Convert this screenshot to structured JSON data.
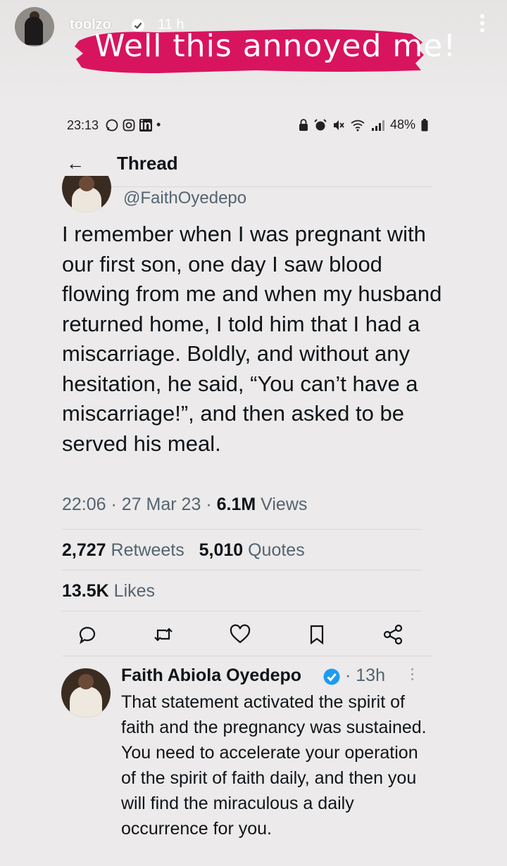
{
  "story": {
    "username": "toolzo",
    "time_ago": "11 h",
    "banner_text": "Well this annoyed me!",
    "banner_color": "#d8145f"
  },
  "status_bar": {
    "time": "23:13",
    "left_icons": [
      "whatsapp-icon",
      "instagram-icon",
      "linkedin-icon",
      "dot"
    ],
    "linkedin_label": "in",
    "battery": "48%"
  },
  "thread": {
    "back_icon": "arrow-left-icon",
    "title": "Thread"
  },
  "main_tweet": {
    "handle": "@FaithOyedepo",
    "text": "I remember when I was pregnant with our first son, one day I saw blood flowing from me and when my husband returned home, I told him that I had a miscarriage. Boldly, and without any hesitation, he said, “You can’t have a miscarriage!”, and then asked to be served his meal.",
    "time": "22:06",
    "date": "27 Mar 23",
    "views_count": "6.1M",
    "views_label": "Views",
    "retweets_count": "2,727",
    "retweets_label": "Retweets",
    "quotes_count": "5,010",
    "quotes_label": "Quotes",
    "likes_count": "13.5K",
    "likes_label": "Likes",
    "actions": [
      "reply-icon",
      "retweet-icon",
      "like-icon",
      "bookmark-icon",
      "share-icon"
    ]
  },
  "reply": {
    "name": "Faith Abiola Oyedepo",
    "time": "13h",
    "text": "That statement activated the spirit of faith and the pregnancy was sustained. You need to accelerate your operation of the spirit of faith daily, and then you will find the miraculous a daily occurrence for you."
  },
  "colors": {
    "text_primary": "#0f1419",
    "text_secondary": "#536471",
    "verified": "#1d9bf0"
  }
}
